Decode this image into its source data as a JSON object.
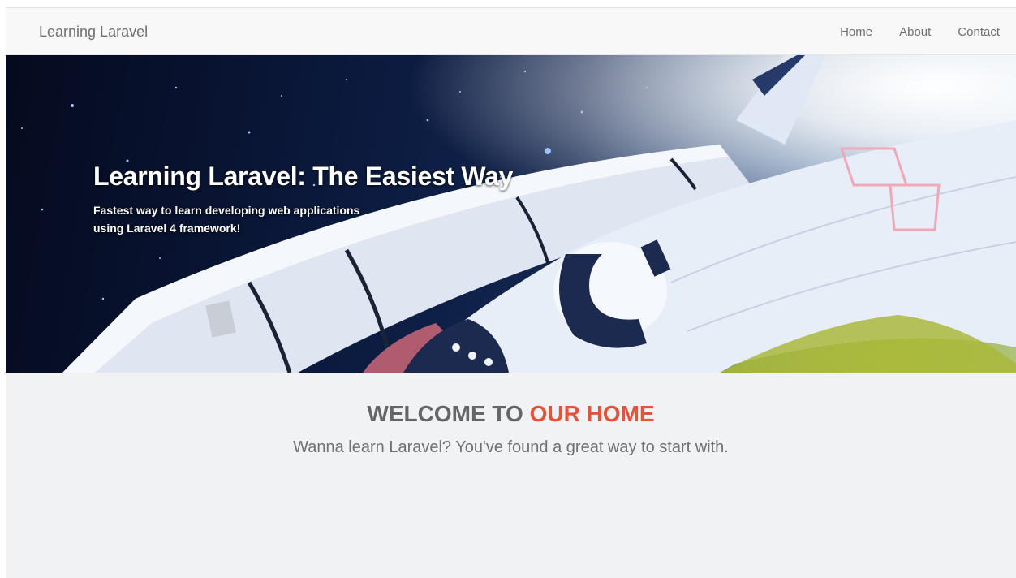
{
  "navbar": {
    "brand": "Learning Laravel",
    "links": [
      "Home",
      "About",
      "Contact"
    ]
  },
  "hero": {
    "title": "Learning Laravel: The Easiest Way",
    "subtitle": "Fastest way to learn developing web applications using Laravel 4 framework!"
  },
  "welcome": {
    "heading_part1": "WELCOME TO",
    "heading_part2": "OUR HOME",
    "subtitle": "Wanna learn Laravel? You've found a great way to start with."
  },
  "colors": {
    "accent": "#e4533b",
    "navbar_bg": "#f8f8f8",
    "page_bg": "#f0f2f4"
  }
}
